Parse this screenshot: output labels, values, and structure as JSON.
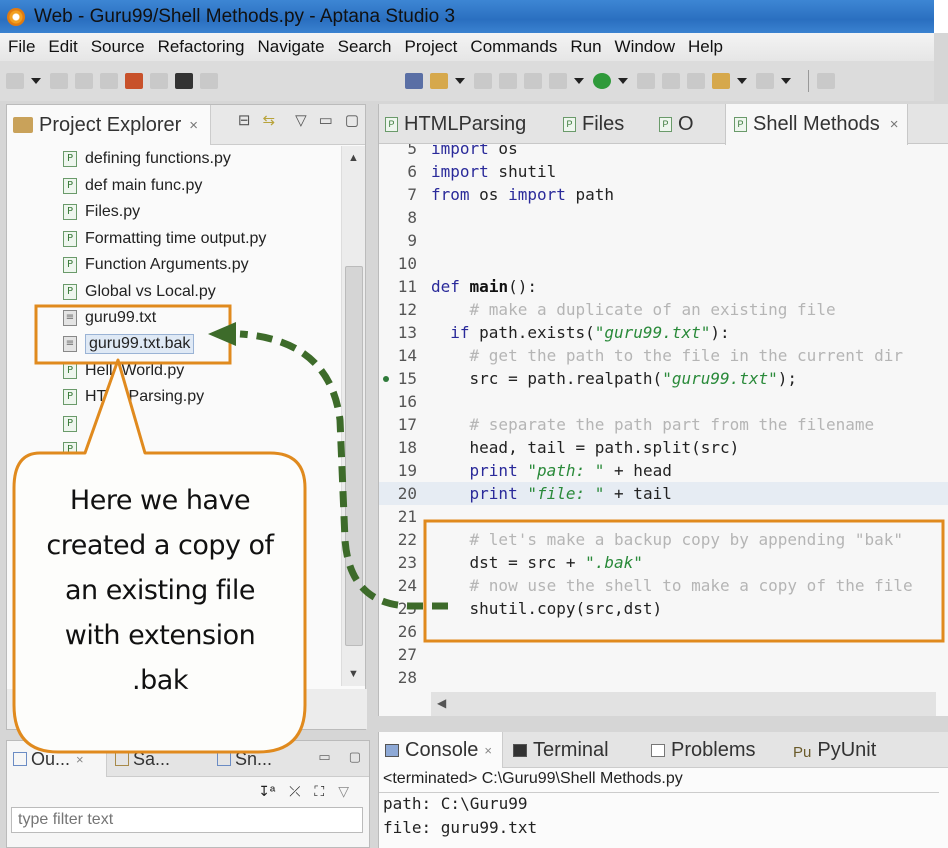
{
  "window": {
    "title": "Web - Guru99/Shell Methods.py - Aptana Studio 3"
  },
  "menu": [
    "File",
    "Edit",
    "Source",
    "Refactoring",
    "Navigate",
    "Search",
    "Project",
    "Commands",
    "Run",
    "Window",
    "Help"
  ],
  "project_explorer": {
    "tab_label": "Project Explorer",
    "files": [
      {
        "name": "defining functions.py",
        "type": "py"
      },
      {
        "name": "def main func.py",
        "type": "py"
      },
      {
        "name": "Files.py",
        "type": "py"
      },
      {
        "name": "Formatting time output.py",
        "type": "py"
      },
      {
        "name": "Function Arguments.py",
        "type": "py"
      },
      {
        "name": "Global vs Local.py",
        "type": "py"
      },
      {
        "name": "guru99.txt",
        "type": "txt"
      },
      {
        "name": "guru99.txt.bak",
        "type": "txt",
        "selected": true
      },
      {
        "name": "HelloWorld.py",
        "type": "py"
      },
      {
        "name": "HTMLParsing.py",
        "type": "py"
      },
      {
        "name": "",
        "type": "py"
      },
      {
        "name": "",
        "type": "py"
      }
    ]
  },
  "outline_panel": {
    "tabs": [
      "Ou...",
      "Sa...",
      "Sn..."
    ],
    "filter_placeholder": "type filter text"
  },
  "editor": {
    "tabs": [
      {
        "label": "HTMLParsing",
        "active": false
      },
      {
        "label": "Files",
        "active": false
      },
      {
        "label": "O",
        "active": false
      },
      {
        "label": "Shell Methods",
        "active": true
      }
    ],
    "lines": [
      {
        "n": "5",
        "html": "<span class='kw'>import</span> os"
      },
      {
        "n": "6",
        "html": "<span class='kw'>import</span> shutil"
      },
      {
        "n": "7",
        "html": "<span class='kw'>from</span> os <span class='kw'>import</span> path"
      },
      {
        "n": "8",
        "html": ""
      },
      {
        "n": "9",
        "html": ""
      },
      {
        "n": "10",
        "html": ""
      },
      {
        "n": "11",
        "html": "<span class='kw'>def</span> <span class='bd'>main</span>():"
      },
      {
        "n": "12",
        "html": "    <span class='cm'># make a duplicate of an existing file</span>"
      },
      {
        "n": "13",
        "html": "  <span class='kw'>if</span> path.exists(<span class='st'>\"guru99.txt\"</span>):"
      },
      {
        "n": "14",
        "html": "    <span class='cm'># get the path to the file in the current dir</span>"
      },
      {
        "n": "15",
        "html": "    src = path.realpath(<span class='st'>\"guru99.txt\"</span>);"
      },
      {
        "n": "16",
        "html": ""
      },
      {
        "n": "17",
        "html": "    <span class='cm'># separate the path part from the filename</span>"
      },
      {
        "n": "18",
        "html": "    head, tail = path.split(src)"
      },
      {
        "n": "19",
        "html": "    <span class='kw'>print</span> <span class='st'>\"path: \"</span> + head"
      },
      {
        "n": "20",
        "html": "    <span class='kw'>print</span> <span class='st'>\"file: \"</span> + tail",
        "highlight": true
      },
      {
        "n": "21",
        "html": ""
      },
      {
        "n": "22",
        "html": "    <span class='cm'># let's make a backup copy by appending \"bak\"</span>"
      },
      {
        "n": "23",
        "html": "    dst = src + <span class='st'>\".bak\"</span>"
      },
      {
        "n": "24",
        "html": "    <span class='cm'># now use the shell to make a copy of the file</span>"
      },
      {
        "n": "25",
        "html": "    shutil.copy(src,dst)"
      },
      {
        "n": "26",
        "html": ""
      },
      {
        "n": "27",
        "html": ""
      },
      {
        "n": "28",
        "html": ""
      }
    ]
  },
  "console": {
    "tabs": [
      "Console",
      "Terminal",
      "Problems",
      "PyUnit"
    ],
    "status": "<terminated> C:\\Guru99\\Shell Methods.py",
    "output": [
      "path: C:\\Guru99",
      "file: guru99.txt"
    ]
  },
  "annotation": {
    "callout_lines": [
      "Here we have",
      "created a copy of",
      "an existing file",
      "with extension",
      ".bak"
    ],
    "highlight_color": "#e08a1e",
    "arrow_color": "#3d6b2a"
  }
}
